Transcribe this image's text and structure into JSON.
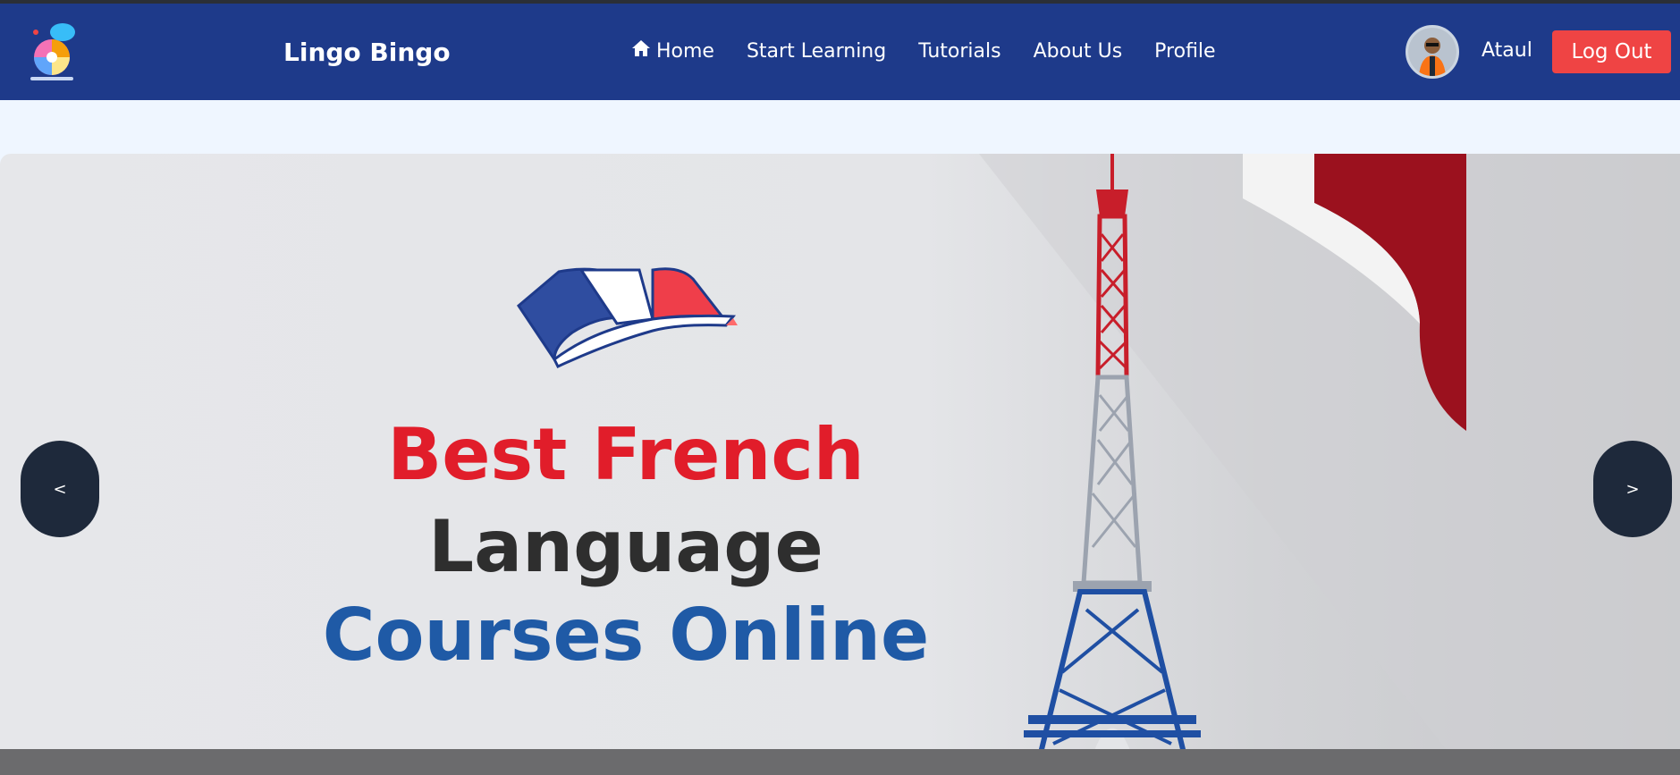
{
  "brand": {
    "name": "Lingo Bingo",
    "logo_icon": "lingo-bingo-logo-icon"
  },
  "nav": {
    "items": [
      {
        "label": "Home",
        "icon": "home-icon"
      },
      {
        "label": "Start Learning"
      },
      {
        "label": "Tutorials"
      },
      {
        "label": "About Us"
      },
      {
        "label": "Profile"
      }
    ]
  },
  "user": {
    "name": "Ataul",
    "avatar_icon": "user-avatar"
  },
  "actions": {
    "logout_label": "Log Out"
  },
  "hero": {
    "line1": "Best French",
    "line2": "Language",
    "line3": "Courses Online",
    "prev_label": "<",
    "next_label": ">"
  },
  "colors": {
    "navbar": "#1e3a8a",
    "logout": "#ef4444",
    "headline_red": "#e11d2a",
    "headline_dark": "#2e2e2e",
    "headline_blue": "#1f5aa6",
    "carousel_button": "#1e293b"
  }
}
